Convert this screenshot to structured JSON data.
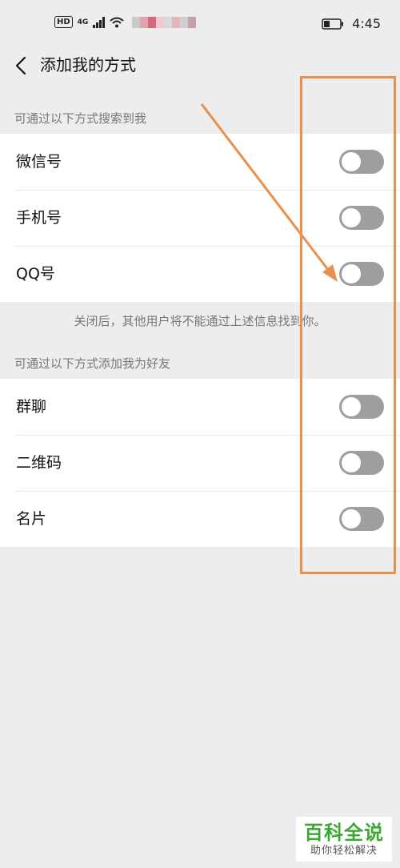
{
  "status_bar": {
    "hd_label": "HD",
    "network_label": "4G",
    "time": "4:45"
  },
  "nav": {
    "title": "添加我的方式",
    "back_icon": "chevron-left-icon"
  },
  "search_section": {
    "header": "可通过以下方式搜索到我",
    "items": [
      {
        "label": "微信号",
        "enabled": false
      },
      {
        "label": "手机号",
        "enabled": false
      },
      {
        "label": "QQ号",
        "enabled": false
      }
    ],
    "note": "关闭后，其他用户将不能通过上述信息找到你。"
  },
  "add_section": {
    "header": "可通过以下方式添加我为好友",
    "items": [
      {
        "label": "群聊",
        "enabled": false
      },
      {
        "label": "二维码",
        "enabled": false
      },
      {
        "label": "名片",
        "enabled": false
      }
    ]
  },
  "annotation": {
    "color": "#e8904d"
  },
  "watermark": {
    "title": "百科全说",
    "subtitle": "助你轻松解决",
    "color": "#3aa832"
  }
}
